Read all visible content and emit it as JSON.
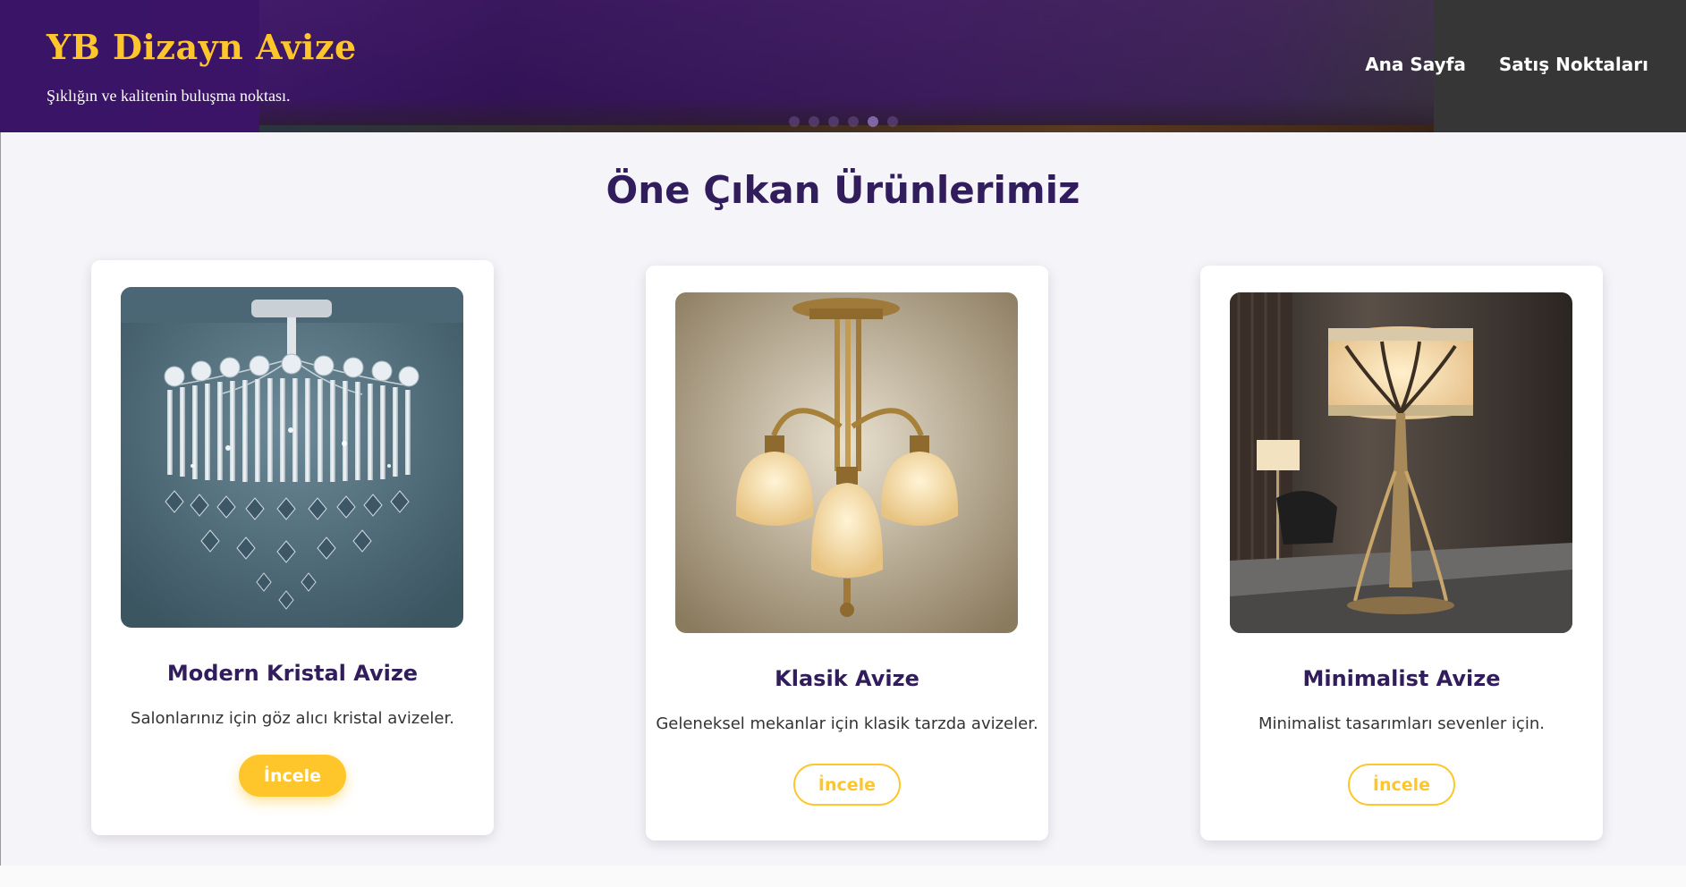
{
  "header": {
    "brand_title": "YB Dizayn Avize",
    "tagline": "Şıklığın ve kalitenin buluşma noktası.",
    "nav": [
      {
        "label": "Ana Sayfa"
      },
      {
        "label": "Satış Noktaları"
      }
    ],
    "hero_slides": 6,
    "hero_active_slide": 4
  },
  "main": {
    "section_title": "Öne Çıkan Ürünlerimiz",
    "products": [
      {
        "title": "Modern Kristal Avize",
        "description": "Salonlarınız için göz alıcı kristal avizeler.",
        "button_label": "İncele",
        "button_style": "filled",
        "image": "crystal-chandelier-photo"
      },
      {
        "title": "Klasik Avize",
        "description": "Geleneksel mekanlar için klasik tarzda avizeler.",
        "button_label": "İncele",
        "button_style": "outline",
        "image": "classic-brass-chandelier-photo"
      },
      {
        "title": "Minimalist Avize",
        "description": "Minimalist tasarımları sevenler için.",
        "button_label": "İncele",
        "button_style": "outline",
        "image": "minimalist-floor-lamp-photo"
      }
    ]
  },
  "colors": {
    "accent": "#ffc62b",
    "heading": "#321d5c",
    "header_purple": "#3a1466",
    "header_dark": "#363636",
    "page_bg": "#f5f4f9"
  }
}
